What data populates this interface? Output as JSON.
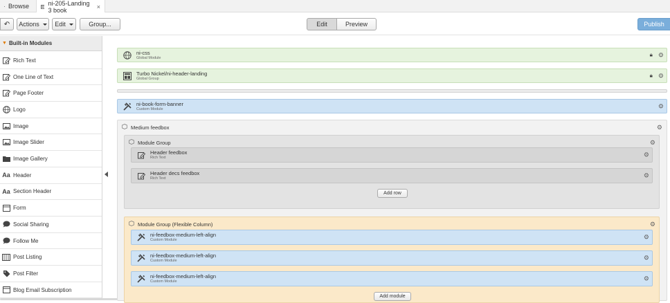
{
  "tabs": [
    {
      "label": "Browse",
      "icon": "folder-icon"
    },
    {
      "label": "ni-205-Landing 3 book",
      "icon": "page-icon",
      "close": "×"
    }
  ],
  "toolbar": {
    "back": "↶",
    "actions": "Actions",
    "edit_menu": "Edit",
    "group": "Group...",
    "mode_edit": "Edit",
    "mode_preview": "Preview",
    "publish": "Publish"
  },
  "sidebar": {
    "header": "Built-in Modules",
    "items": [
      {
        "label": "Rich Text",
        "icon": "pencil-icon"
      },
      {
        "label": "One Line of Text",
        "icon": "pencil-icon"
      },
      {
        "label": "Page Footer",
        "icon": "pencil-icon"
      },
      {
        "label": "Logo",
        "icon": "globe-icon"
      },
      {
        "label": "Image",
        "icon": "image-icon"
      },
      {
        "label": "Image Slider",
        "icon": "image-icon"
      },
      {
        "label": "Image Gallery",
        "icon": "folder-icon"
      },
      {
        "label": "Header",
        "icon": "aa-icon"
      },
      {
        "label": "Section Header",
        "icon": "aa-icon"
      },
      {
        "label": "Form",
        "icon": "form-icon"
      },
      {
        "label": "Social Sharing",
        "icon": "speech-bubble-icon"
      },
      {
        "label": "Follow Me",
        "icon": "speech-bubble-icon"
      },
      {
        "label": "Post Listing",
        "icon": "list-icon"
      },
      {
        "label": "Post Filter",
        "icon": "tag-icon"
      },
      {
        "label": "Blog Email Subscription",
        "icon": "form-icon"
      }
    ]
  },
  "canvas": {
    "global1": {
      "title": "ni-css",
      "sub": "Global Module"
    },
    "global2": {
      "title": "Turbo Nickel/ni-header-landing",
      "sub": "Global Group"
    },
    "banner": {
      "title": "ni-book-form-banner",
      "sub": "Custom Module"
    },
    "medium": {
      "title": "Medium feedbox",
      "group1": {
        "title": "Module Group",
        "rows": [
          {
            "title": "Header feedbox",
            "sub": "Rich Text"
          },
          {
            "title": "Header decs feedbox",
            "sub": "Rich Text"
          }
        ],
        "add": "Add row"
      },
      "group2": {
        "title": "Module Group (Flexible Column)",
        "rows": [
          {
            "title": "ni-feedbox-medium-left-align",
            "sub": "Custom Module"
          },
          {
            "title": "ni-feedbox-medium-left-align",
            "sub": "Custom Module"
          },
          {
            "title": "ni-feedbox-medium-left-align",
            "sub": "Custom Module"
          }
        ],
        "add": "Add module"
      }
    }
  },
  "colors": {
    "global_bg": "#e6f3de",
    "custom_bg": "#cfe3f5",
    "flex_group_bg": "#fbe9c9",
    "publish_bg": "#7aaedb"
  }
}
